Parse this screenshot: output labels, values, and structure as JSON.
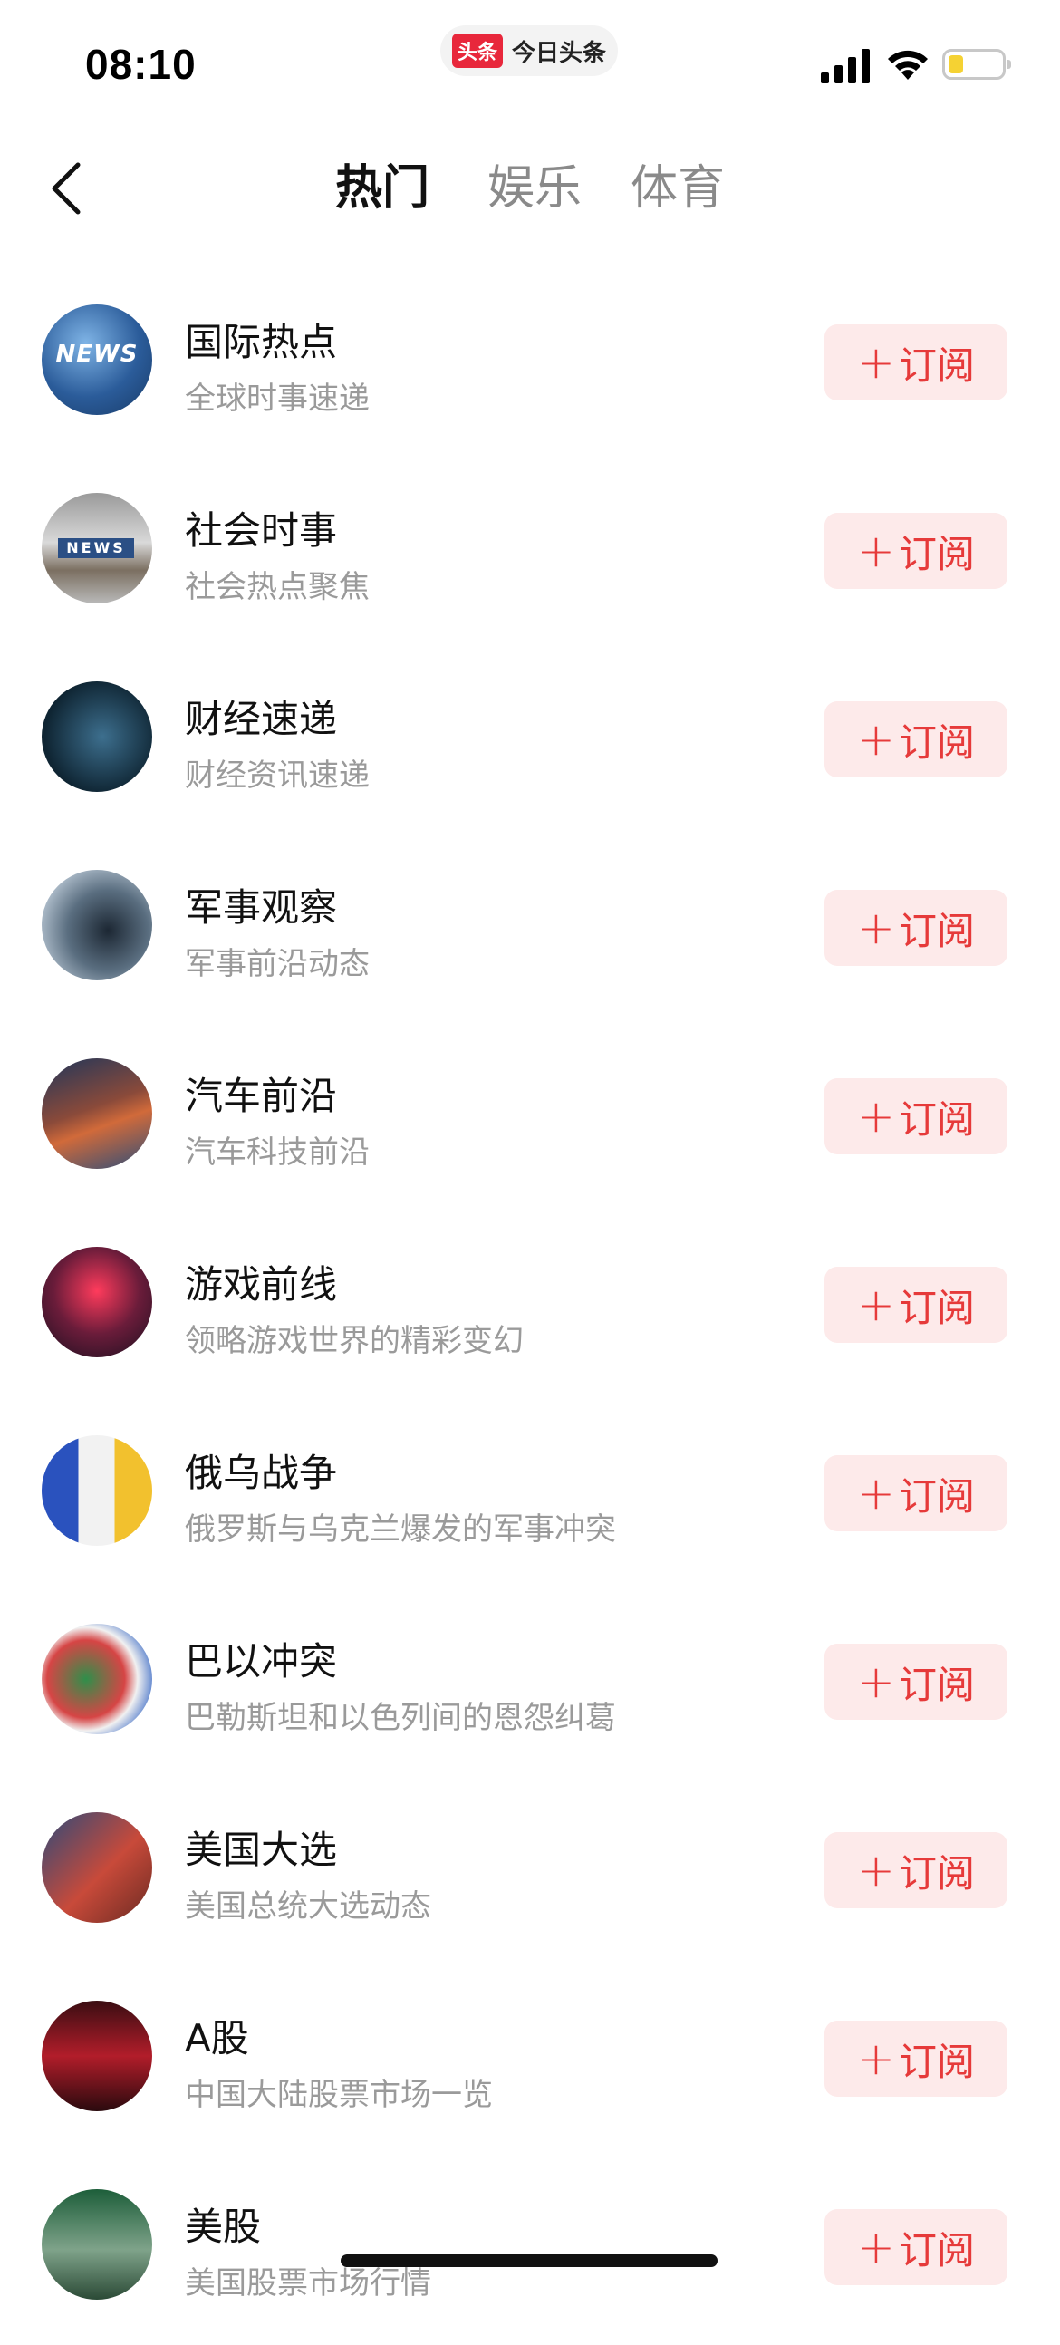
{
  "status_bar": {
    "time": "08:10",
    "app_badge": "头条",
    "app_name": "今日头条",
    "battery_color": "#f5d233"
  },
  "nav": {
    "back_icon": "chevron-left-icon",
    "tabs": [
      {
        "label": "热门",
        "active": true
      },
      {
        "label": "娱乐",
        "active": false
      },
      {
        "label": "体育",
        "active": false
      }
    ]
  },
  "subscribe_label": "订阅",
  "accent_color": "#e63a3a",
  "channels": [
    {
      "title": "国际热点",
      "subtitle": "全球时事速递",
      "avatar_text": "NEWS"
    },
    {
      "title": "社会时事",
      "subtitle": "社会热点聚焦",
      "avatar_text": "NEWS"
    },
    {
      "title": "财经速递",
      "subtitle": "财经资讯速递"
    },
    {
      "title": "军事观察",
      "subtitle": "军事前沿动态"
    },
    {
      "title": "汽车前沿",
      "subtitle": "汽车科技前沿"
    },
    {
      "title": "游戏前线",
      "subtitle": "领略游戏世界的精彩变幻"
    },
    {
      "title": "俄乌战争",
      "subtitle": "俄罗斯与乌克兰爆发的军事冲突"
    },
    {
      "title": "巴以冲突",
      "subtitle": "巴勒斯坦和以色列间的恩怨纠葛"
    },
    {
      "title": "美国大选",
      "subtitle": "美国总统大选动态"
    },
    {
      "title": "A股",
      "subtitle": "中国大陆股票市场一览"
    },
    {
      "title": "美股",
      "subtitle": "美国股票市场行情"
    }
  ]
}
